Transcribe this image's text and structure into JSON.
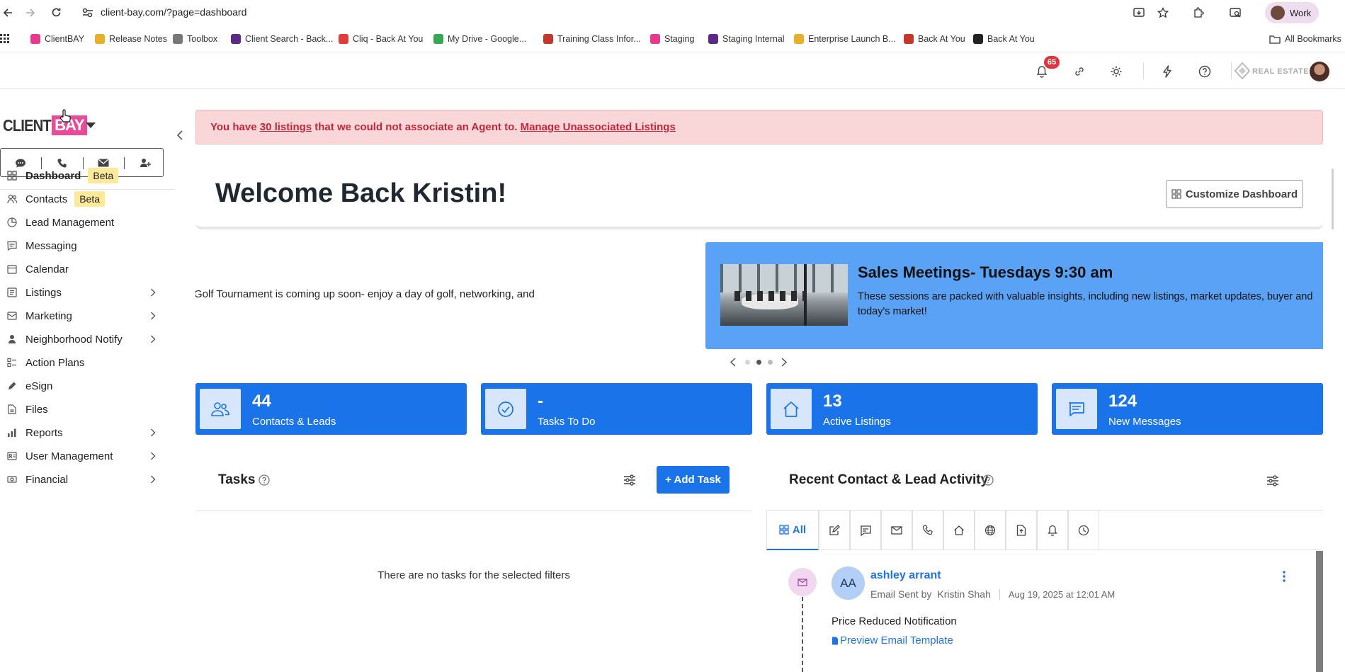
{
  "browser": {
    "url": "client-bay.com/?page=dashboard",
    "profile_label": "Work",
    "all_bookmarks": "All Bookmarks",
    "bookmarks": [
      {
        "label": "ClientBAY",
        "color": "#e8398f"
      },
      {
        "label": "Release Notes",
        "color": "#e8b02a"
      },
      {
        "label": "Toolbox",
        "color": "#777777"
      },
      {
        "label": "Client Search - Back...",
        "color": "#5b2a86"
      },
      {
        "label": "Cliq - Back At You",
        "color": "#e23b3b"
      },
      {
        "label": "My Drive - Google...",
        "color": "#34a853"
      },
      {
        "label": "Training Class Infor...",
        "color": "#c0392b"
      },
      {
        "label": "Staging",
        "color": "#e8398f"
      },
      {
        "label": "Staging Internal",
        "color": "#5b2a86"
      },
      {
        "label": "Enterprise Launch B...",
        "color": "#e8b02a"
      },
      {
        "label": "Back At You",
        "color": "#c0392b"
      },
      {
        "label": "Back At You",
        "color": "#222222"
      }
    ]
  },
  "header": {
    "notification_count": "65",
    "brand_label": "REAL ESTATE"
  },
  "sidebar": {
    "logo_text_left": "CLIENT",
    "logo_text_right": "BAY",
    "nav": [
      {
        "label": "Dashboard",
        "icon": "grid-icon",
        "badge": "Beta",
        "active": true,
        "chevron": false
      },
      {
        "label": "Contacts",
        "icon": "users-icon",
        "badge": "Beta",
        "chevron": false
      },
      {
        "label": "Lead Management",
        "icon": "pie-icon",
        "badge": "",
        "chevron": false
      },
      {
        "label": "Messaging",
        "icon": "message-icon",
        "badge": "",
        "chevron": false
      },
      {
        "label": "Calendar",
        "icon": "calendar-icon",
        "badge": "",
        "chevron": false
      },
      {
        "label": "Listings",
        "icon": "list-icon",
        "badge": "",
        "chevron": true
      },
      {
        "label": "Marketing",
        "icon": "mail-icon",
        "badge": "",
        "chevron": true
      },
      {
        "label": "Neighborhood Notify",
        "icon": "person-pin-icon",
        "badge": "",
        "chevron": true
      },
      {
        "label": "Action Plans",
        "icon": "plan-icon",
        "badge": "",
        "chevron": false
      },
      {
        "label": "eSign",
        "icon": "pen-icon",
        "badge": "",
        "chevron": false
      },
      {
        "label": "Files",
        "icon": "file-icon",
        "badge": "",
        "chevron": false
      },
      {
        "label": "Reports",
        "icon": "bar-chart-icon",
        "badge": "",
        "chevron": true
      },
      {
        "label": "User Management",
        "icon": "id-card-icon",
        "badge": "",
        "chevron": true
      },
      {
        "label": "Financial",
        "icon": "money-icon",
        "badge": "",
        "chevron": true
      }
    ]
  },
  "alert": {
    "prefix": "You have ",
    "link_count": "30 listings",
    "middle": " that we could not associate an Agent to. ",
    "manage_link": "Manage Unassociated Listings"
  },
  "welcome": {
    "title": "Welcome Back Kristin!",
    "customize_label": "Customize Dashboard"
  },
  "carousel": {
    "left_text": "Golf Tournament is coming up soon- enjoy a day of golf, networking, and",
    "card_title": "Sales Meetings- Tuesdays 9:30 am",
    "card_body": "These sessions are packed with valuable insights, including new listings, market updates, buyer and today's market!",
    "active_dot": 2,
    "dot_count": 3
  },
  "stats": [
    {
      "value": "44",
      "label": "Contacts & Leads",
      "icon": "users-icon"
    },
    {
      "value": "-",
      "label": "Tasks To Do",
      "icon": "check-circle-icon"
    },
    {
      "value": "13",
      "label": "Active Listings",
      "icon": "house-icon"
    },
    {
      "value": "124",
      "label": "New Messages",
      "icon": "message-icon"
    }
  ],
  "tasks": {
    "title": "Tasks",
    "add_label": "+ Add Task",
    "empty": "There are no tasks for the selected filters"
  },
  "activity": {
    "title": "Recent Contact & Lead Activity",
    "all_tab": "All",
    "item": {
      "initials": "AA",
      "name": "ashley arrant",
      "action": "Email Sent by",
      "by": "Kristin Shah",
      "date": "Aug 19, 2025 at 12:01 AM",
      "subject": "Price Reduced Notification",
      "preview_link": "Preview Email Template"
    }
  },
  "colors": {
    "primary": "#1a73e8",
    "alert_bg": "#f9d6d8",
    "alert_text": "#c0283a",
    "beta_badge": "#fde99a",
    "notification": "#e5323b",
    "carousel_card": "#5aa2f5"
  }
}
